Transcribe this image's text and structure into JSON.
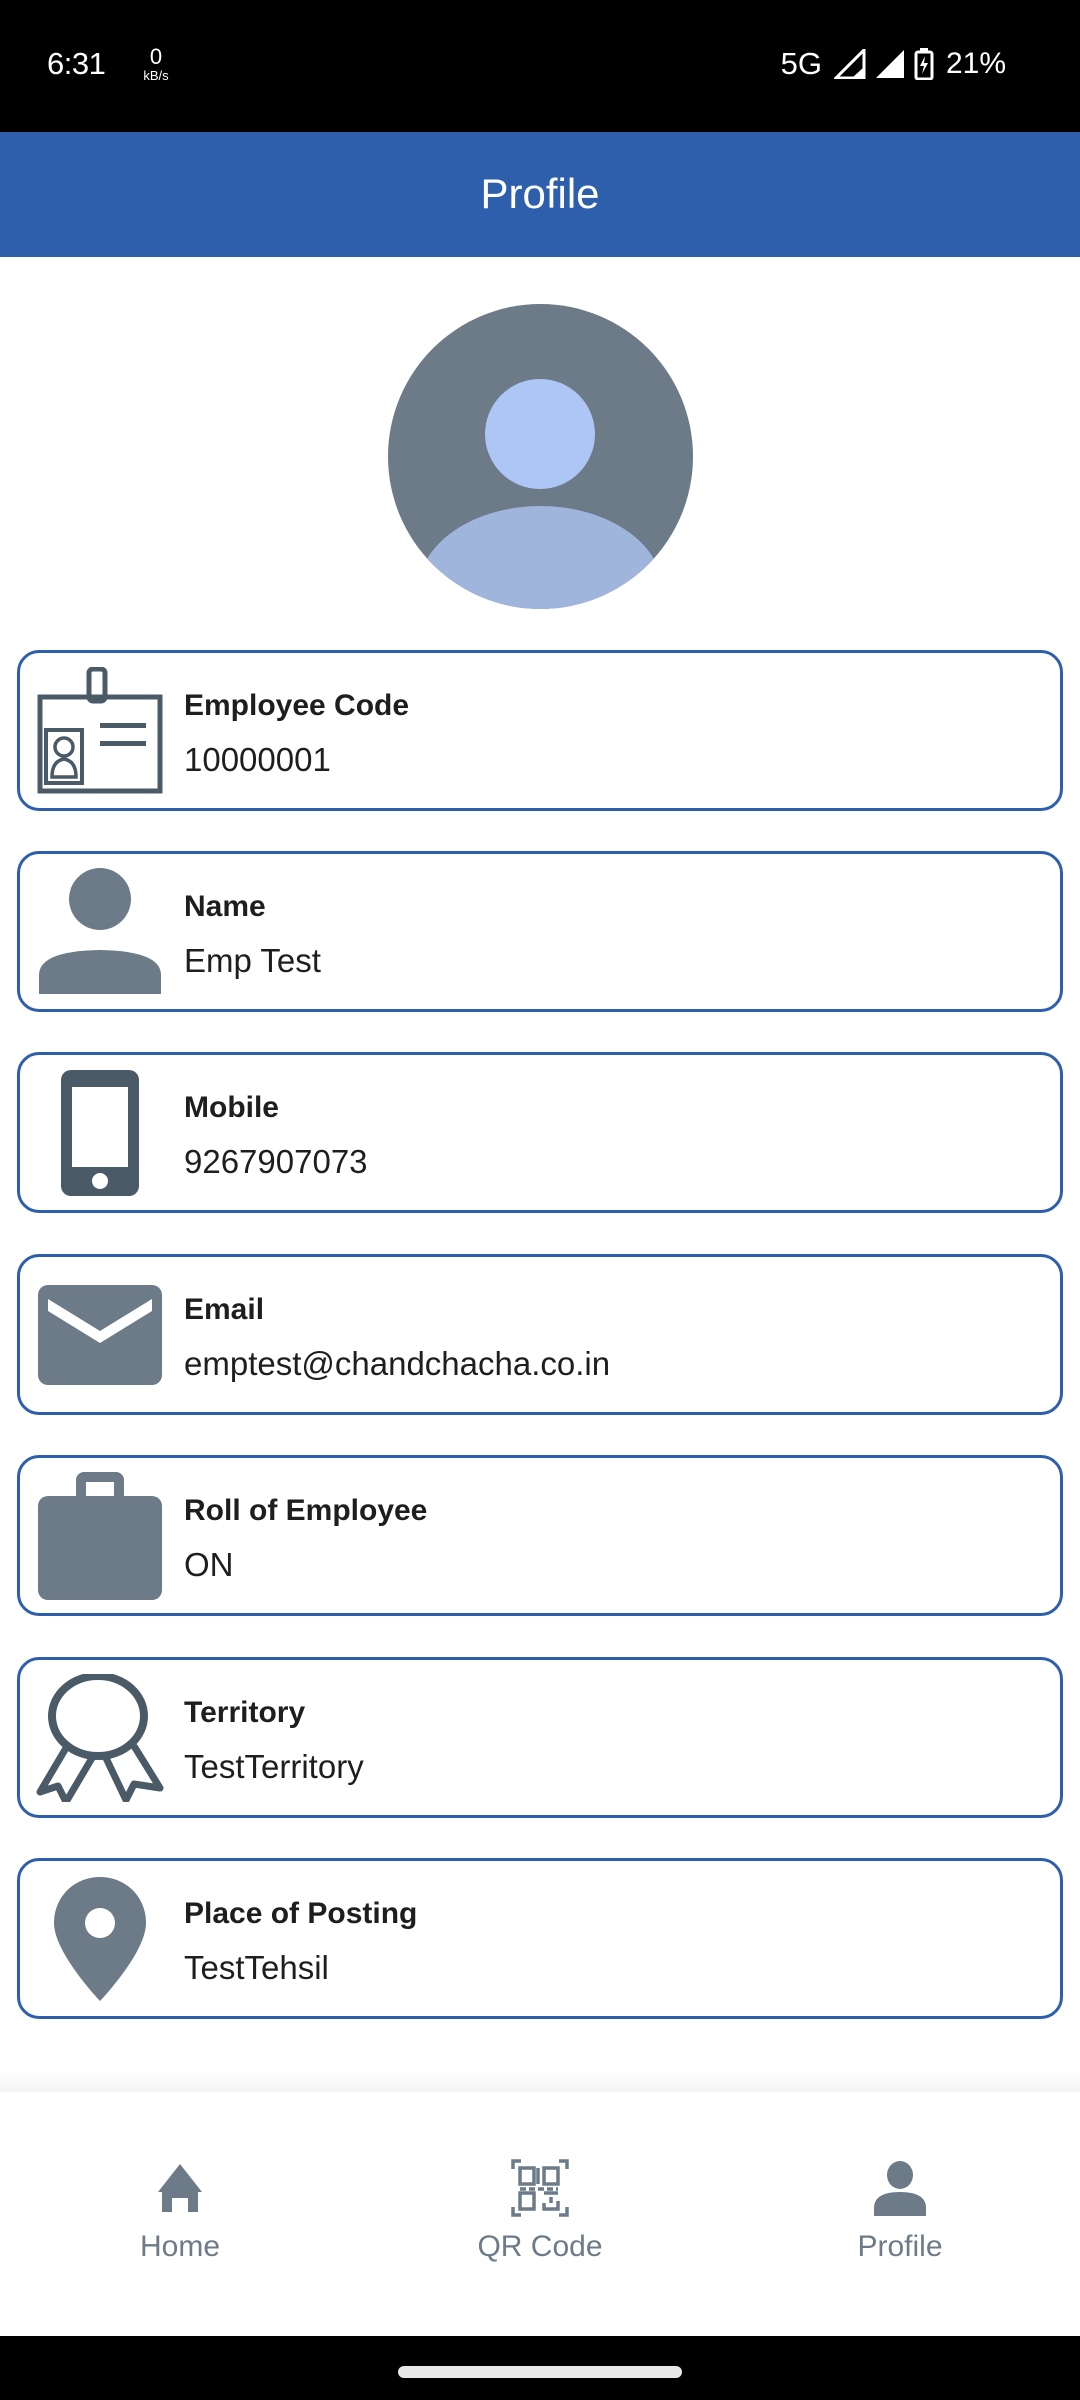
{
  "status_bar": {
    "time": "6:31",
    "speed_value": "0",
    "speed_unit": "kB/s",
    "network": "5G",
    "battery_percent": "21%",
    "icons": [
      "signal-icon",
      "signal-icon",
      "battery-charging-icon"
    ]
  },
  "app_bar": {
    "title": "Profile"
  },
  "avatar": {
    "icon": "user-avatar-icon"
  },
  "profile_fields": [
    {
      "label": "Employee Code",
      "value": "10000001",
      "icon": "id-badge-icon"
    },
    {
      "label": "Name",
      "value": "Emp Test",
      "icon": "person-icon"
    },
    {
      "label": "Mobile",
      "value": "9267907073",
      "icon": "mobile-phone-icon"
    },
    {
      "label": "Email",
      "value": "emptest@chandchacha.co.in",
      "icon": "envelope-icon"
    },
    {
      "label": "Roll of Employee",
      "value": "ON",
      "icon": "briefcase-icon"
    },
    {
      "label": "Territory",
      "value": "TestTerritory",
      "icon": "award-ribbon-icon"
    },
    {
      "label": "Place of Posting",
      "value": "TestTehsil",
      "icon": "location-pin-icon"
    }
  ],
  "bottom_nav": {
    "items": [
      {
        "label": "Home",
        "icon": "home-icon"
      },
      {
        "label": "QR Code",
        "icon": "qr-code-icon"
      },
      {
        "label": "Profile",
        "icon": "person-icon",
        "active": true
      }
    ]
  },
  "colors": {
    "primary": "#2e5fac",
    "icon_gray": "#6c7b87",
    "icon_dark": "#4a5a66",
    "text": "#1e1e1e"
  }
}
